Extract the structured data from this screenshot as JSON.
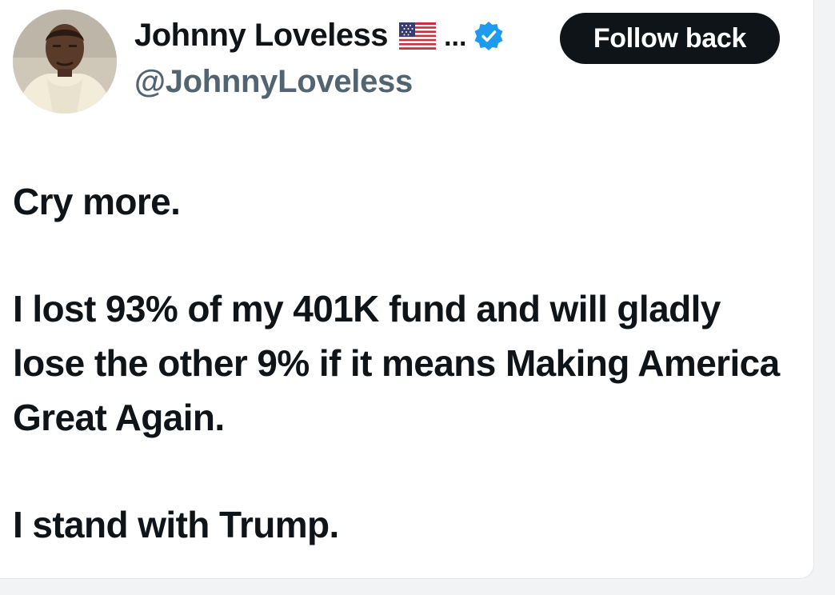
{
  "tweet": {
    "author": {
      "display_name": "Johnny Loveless",
      "flag_emoji_icon": "us-flag-icon",
      "truncation": "...",
      "verified_icon": "verified-badge-icon",
      "handle": "@JohnnyLoveless",
      "avatar_icon": "profile-photo"
    },
    "follow_button_label": "Follow back",
    "paragraphs": [
      "Cry more.",
      "I lost 93% of my 401K fund and will gladly lose the other 9% if it means Making America Great Again.",
      "I stand with Trump."
    ]
  },
  "colors": {
    "text_primary": "#0f1419",
    "text_secondary": "#536471",
    "verified_blue": "#1d9bf0",
    "button_bg": "#0f1419",
    "button_text": "#ffffff"
  }
}
